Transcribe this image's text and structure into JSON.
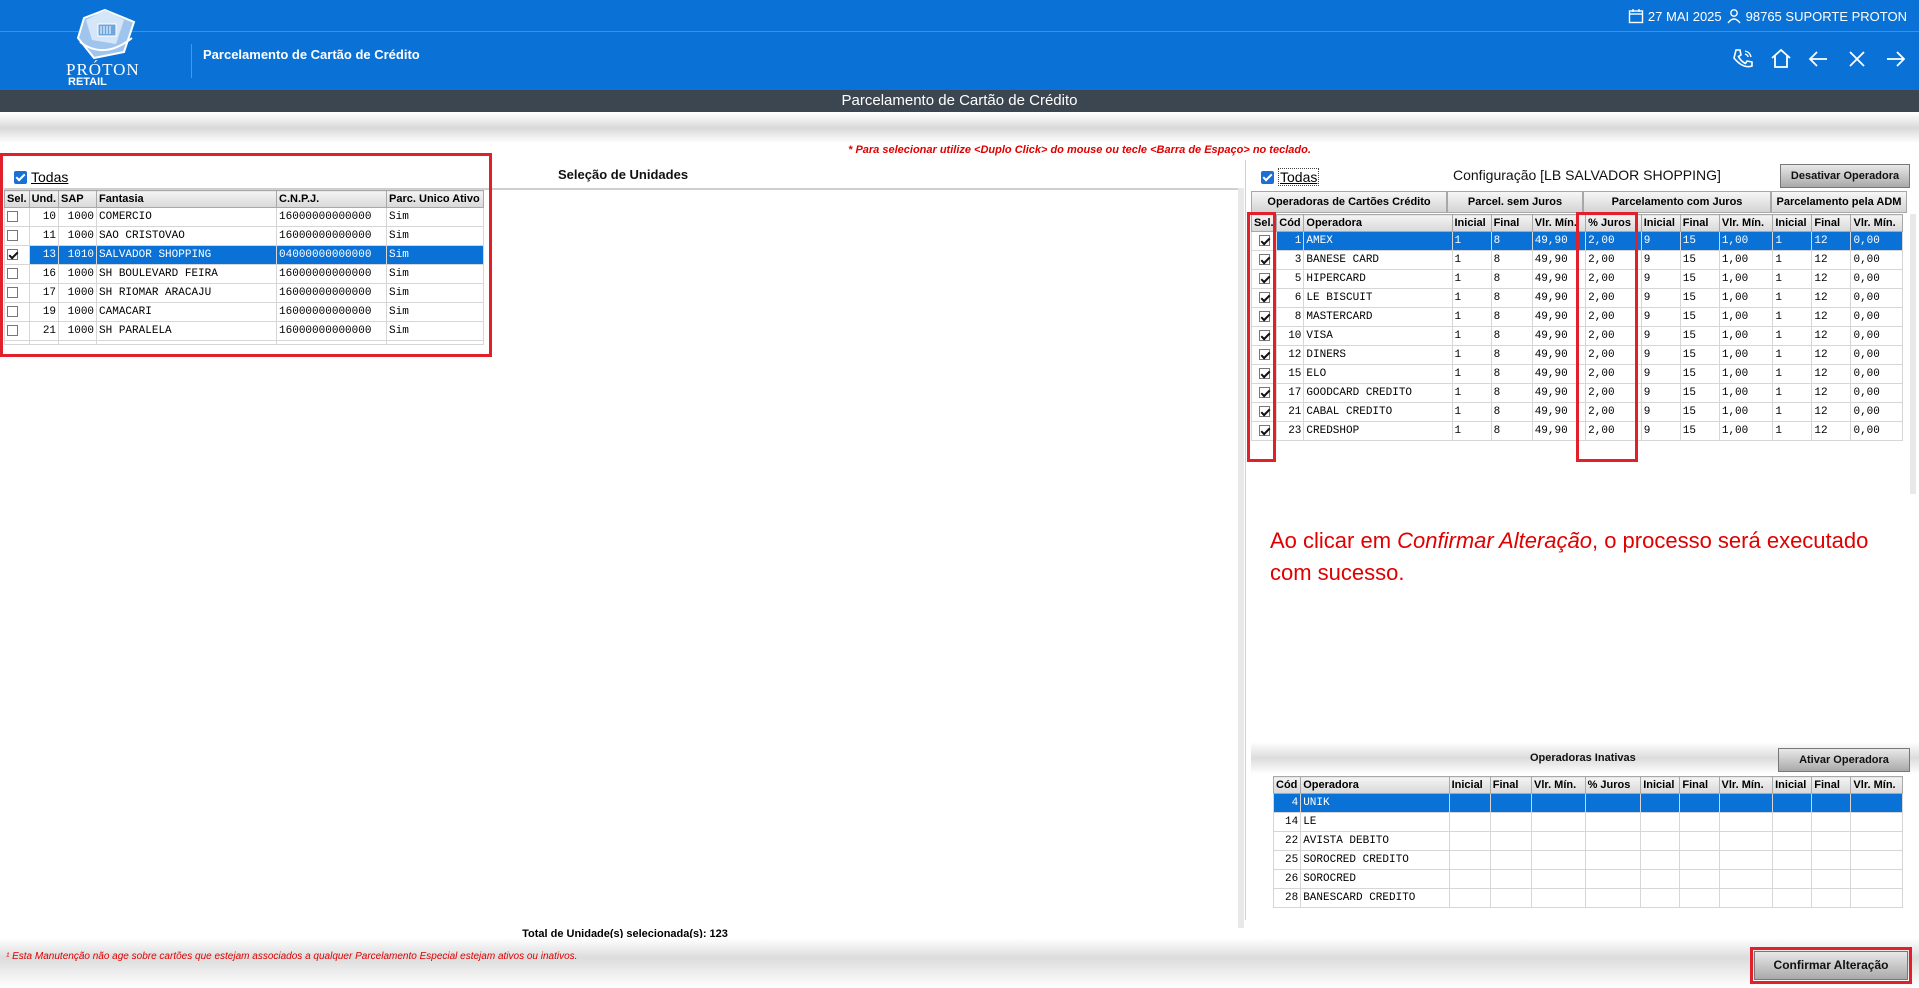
{
  "header": {
    "logo_text": "PRÓTON",
    "logo_sub": "RETAIL",
    "app_title": "Parcelamento de Cartão de Crédito",
    "date": "27 MAI 2025",
    "user": "98765 SUPORTE PROTON"
  },
  "window_title": "Parcelamento de Cartão de Crédito",
  "hint": "* Para selecionar utilize <Duplo Click> do mouse ou tecle <Barra de Espaço> no teclado.",
  "units": {
    "todas_label": "Todas",
    "section_title": "Seleção de Unidades",
    "columns": [
      "Sel.",
      "Und.",
      "SAP",
      "Fantasia",
      "C.N.P.J.",
      "Parc. Unico Ativo"
    ],
    "rows": [
      {
        "sel": false,
        "und": "10",
        "sap": "1000",
        "fantasia": "COMERCIO",
        "cnpj": "16000000000000",
        "parc": "Sim"
      },
      {
        "sel": false,
        "und": "11",
        "sap": "1000",
        "fantasia": "SAO CRISTOVAO",
        "cnpj": "16000000000000",
        "parc": "Sim"
      },
      {
        "sel": true,
        "und": "13",
        "sap": "1010",
        "fantasia": "SALVADOR SHOPPING",
        "cnpj": "04000000000000",
        "parc": "Sim"
      },
      {
        "sel": false,
        "und": "16",
        "sap": "1000",
        "fantasia": "SH BOULEVARD FEIRA",
        "cnpj": "16000000000000",
        "parc": "Sim"
      },
      {
        "sel": false,
        "und": "17",
        "sap": "1000",
        "fantasia": "SH RIOMAR ARACAJU",
        "cnpj": "16000000000000",
        "parc": "Sim"
      },
      {
        "sel": false,
        "und": "19",
        "sap": "1000",
        "fantasia": "CAMACARI",
        "cnpj": "16000000000000",
        "parc": "Sim"
      },
      {
        "sel": false,
        "und": "21",
        "sap": "1000",
        "fantasia": "SH PARALELA",
        "cnpj": "16000000000000",
        "parc": "Sim"
      }
    ],
    "total_label": "Total de Unidade(s) selecionada(s): 123"
  },
  "config": {
    "todas_label": "Todas",
    "title": "Configuração [LB SALVADOR SHOPPING]",
    "deactivate_button": "Desativar Operadora",
    "tabs": [
      "Operadoras de Cartões Crédito",
      "Parcel.  sem Juros",
      "Parcelamento  com Juros",
      "Parcelamento pela ADM"
    ],
    "columns": [
      "Sel.",
      "Cód",
      "Operadora",
      "Inicial",
      "Final",
      "Vlr. Mín.",
      "% Juros",
      "Inicial",
      "Final",
      "Vlr. Mín.",
      "Inicial",
      "Final",
      "Vlr. Mín."
    ],
    "rows": [
      {
        "cod": "1",
        "op": "AMEX",
        "c": [
          "1",
          "8",
          "49,90",
          "2,00",
          "9",
          "15",
          "1,00",
          "1",
          "12",
          "0,00"
        ]
      },
      {
        "cod": "3",
        "op": "BANESE CARD",
        "c": [
          "1",
          "8",
          "49,90",
          "2,00",
          "9",
          "15",
          "1,00",
          "1",
          "12",
          "0,00"
        ]
      },
      {
        "cod": "5",
        "op": "HIPERCARD",
        "c": [
          "1",
          "8",
          "49,90",
          "2,00",
          "9",
          "15",
          "1,00",
          "1",
          "12",
          "0,00"
        ]
      },
      {
        "cod": "6",
        "op": "LE BISCUIT",
        "c": [
          "1",
          "8",
          "49,90",
          "2,00",
          "9",
          "15",
          "1,00",
          "1",
          "12",
          "0,00"
        ]
      },
      {
        "cod": "8",
        "op": "MASTERCARD",
        "c": [
          "1",
          "8",
          "49,90",
          "2,00",
          "9",
          "15",
          "1,00",
          "1",
          "12",
          "0,00"
        ]
      },
      {
        "cod": "10",
        "op": "VISA",
        "c": [
          "1",
          "8",
          "49,90",
          "2,00",
          "9",
          "15",
          "1,00",
          "1",
          "12",
          "0,00"
        ]
      },
      {
        "cod": "12",
        "op": "DINERS",
        "c": [
          "1",
          "8",
          "49,90",
          "2,00",
          "9",
          "15",
          "1,00",
          "1",
          "12",
          "0,00"
        ]
      },
      {
        "cod": "15",
        "op": "ELO",
        "c": [
          "1",
          "8",
          "49,90",
          "2,00",
          "9",
          "15",
          "1,00",
          "1",
          "12",
          "0,00"
        ]
      },
      {
        "cod": "17",
        "op": "GOODCARD CREDITO",
        "c": [
          "1",
          "8",
          "49,90",
          "2,00",
          "9",
          "15",
          "1,00",
          "1",
          "12",
          "0,00"
        ]
      },
      {
        "cod": "21",
        "op": "CABAL CREDITO",
        "c": [
          "1",
          "8",
          "49,90",
          "2,00",
          "9",
          "15",
          "1,00",
          "1",
          "12",
          "0,00"
        ]
      },
      {
        "cod": "23",
        "op": "CREDSHOP",
        "c": [
          "1",
          "8",
          "49,90",
          "2,00",
          "9",
          "15",
          "1,00",
          "1",
          "12",
          "0,00"
        ]
      }
    ]
  },
  "message": {
    "part1": "Ao clicar em ",
    "emph": "Confirmar Alteração",
    "part2": ", o processo será executado com sucesso."
  },
  "inactive": {
    "title": "Operadoras Inativas",
    "activate_button": "Ativar Operadora",
    "columns": [
      "Cód",
      "Operadora",
      "Inicial",
      "Final",
      "Vlr. Mín.",
      "% Juros",
      "Inicial",
      "Final",
      "Vlr. Mín.",
      "Inicial",
      "Final",
      "Vlr. Mín."
    ],
    "rows": [
      {
        "cod": "4",
        "op": "UNIK"
      },
      {
        "cod": "14",
        "op": "LE"
      },
      {
        "cod": "22",
        "op": "AVISTA DEBITO"
      },
      {
        "cod": "25",
        "op": "SOROCRED CREDITO"
      },
      {
        "cod": "26",
        "op": "SOROCRED"
      },
      {
        "cod": "28",
        "op": "BANESCARD CREDITO"
      }
    ]
  },
  "footer": {
    "note": "¹ Esta Manutenção não age sobre cartões que estejam associados a qualquer Parcelamento Especial estejam ativos ou inativos.",
    "confirm_button": "Confirmar Alteração"
  },
  "colors": {
    "brand": "#0a72d6",
    "titlebar": "#3b4650",
    "highlight": "#e0202a"
  }
}
